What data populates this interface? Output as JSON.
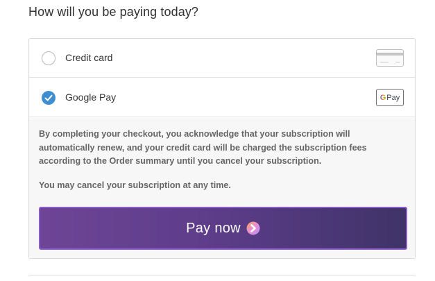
{
  "heading": "How will you be paying today?",
  "options": [
    {
      "label": "Credit card",
      "selected": false,
      "icon": "credit-card-icon"
    },
    {
      "label": "Google Pay",
      "selected": true,
      "icon": "google-pay-icon",
      "icon_text": "Pay"
    }
  ],
  "details": {
    "notice": "By completing your checkout, you acknowledge that your subscription will automatically renew, and your credit card will be charged the subscription fees according to the Order summary until you cancel your subscription.",
    "cancel_note": "You may cancel your subscription at any time."
  },
  "pay_button": {
    "label": "Pay now",
    "icon": "arrow-right-icon"
  },
  "colors": {
    "radio_selected": "#3f8fd0",
    "button_start": "#6e4596",
    "button_end": "#3f3368",
    "button_border": "#8a5cc8"
  }
}
